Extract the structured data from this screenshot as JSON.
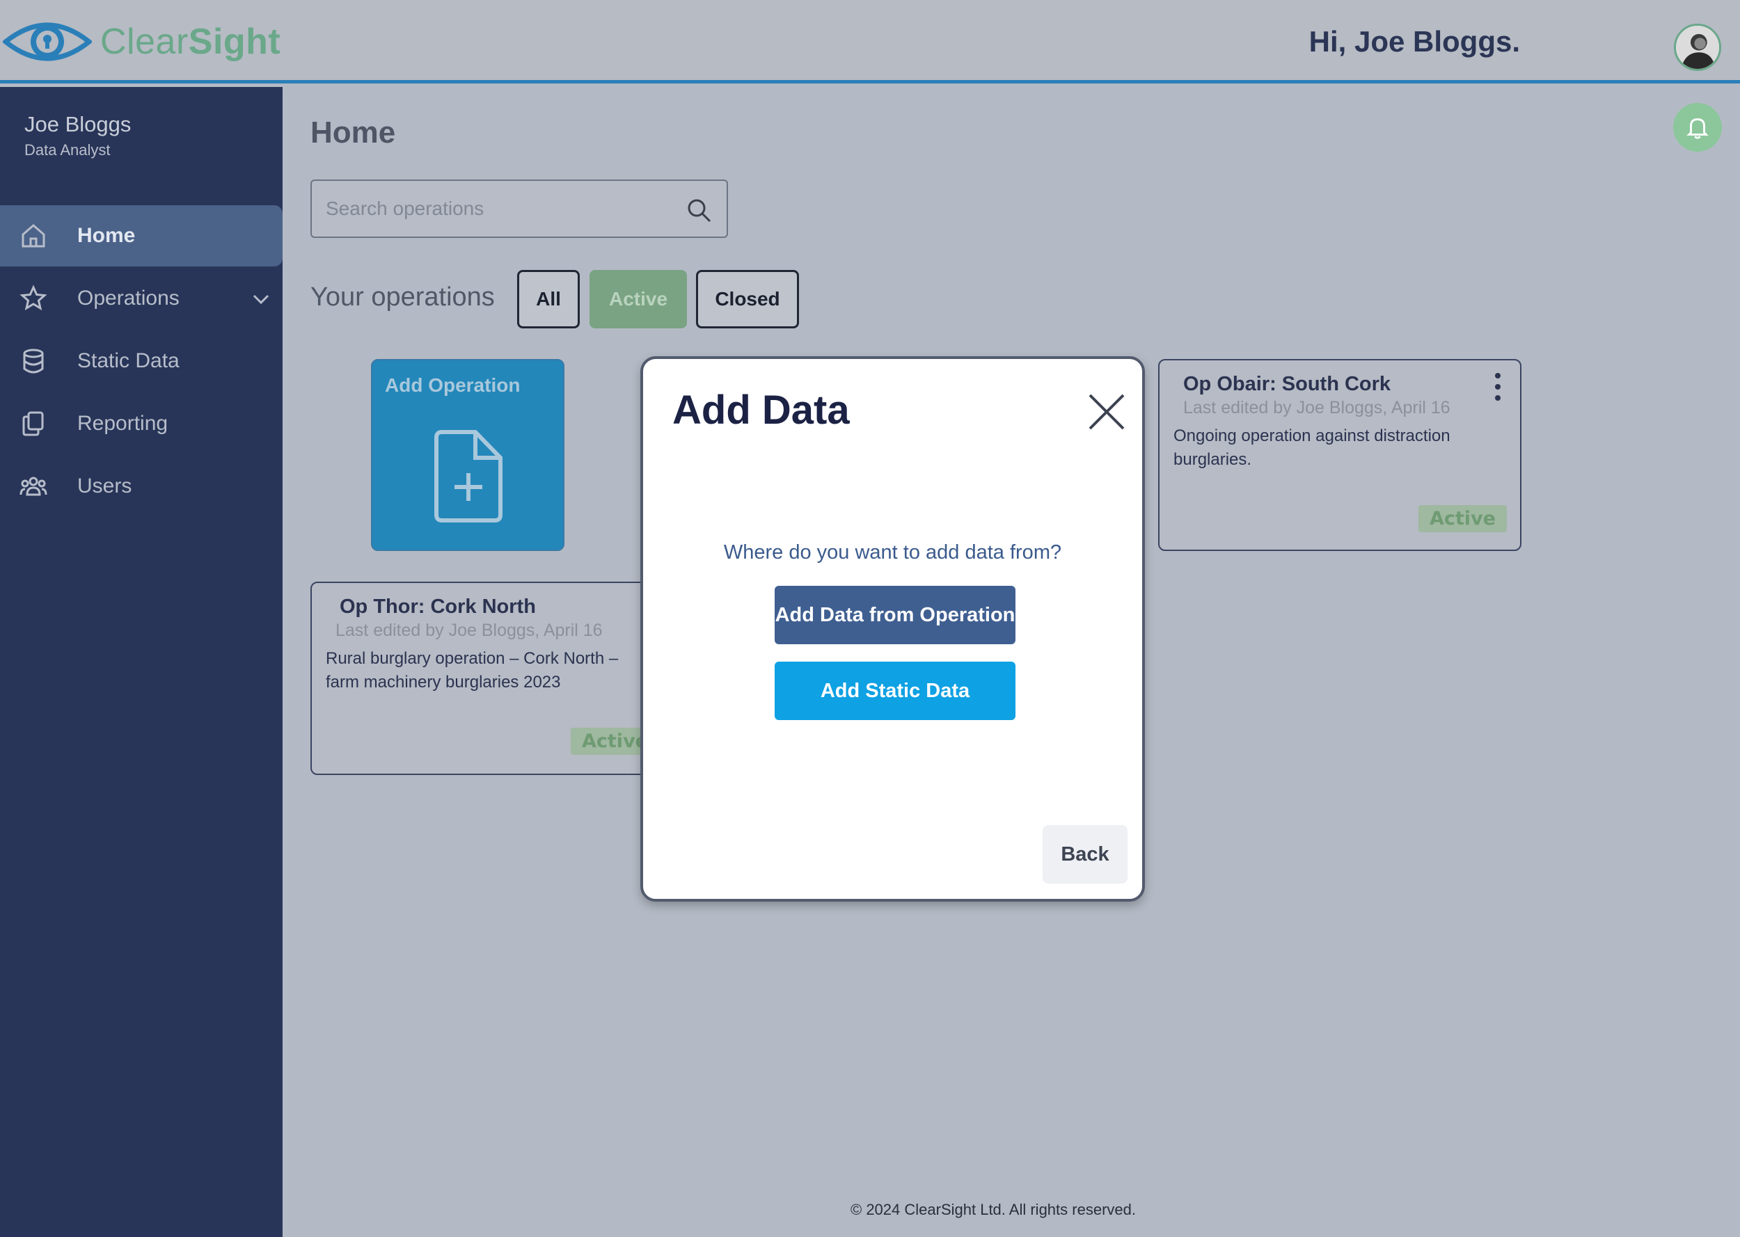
{
  "app": {
    "brand_light": "Clear",
    "brand_bold": "Sight",
    "greeting": "Hi, Joe Bloggs."
  },
  "user": {
    "name": "Joe Bloggs",
    "role": "Data Analyst"
  },
  "sidebar": {
    "items": [
      {
        "label": "Home",
        "icon": "home-icon",
        "active": true
      },
      {
        "label": "Operations",
        "icon": "star-icon",
        "has_chevron": true
      },
      {
        "label": "Static Data",
        "icon": "database-icon"
      },
      {
        "label": "Reporting",
        "icon": "copy-document-icon"
      },
      {
        "label": "Users",
        "icon": "users-icon"
      }
    ]
  },
  "main": {
    "page_title": "Home",
    "search_placeholder": "Search operations",
    "ops_heading": "Your operations",
    "filters": {
      "all": "All",
      "active": "Active",
      "closed": "Closed"
    },
    "add_operation_label": "Add Operation",
    "cards": [
      {
        "title": "Op Thor: Cork North",
        "edited": "Last edited by Joe Bloggs, April 16",
        "description_line1": "Rural burglary operation – Cork North –",
        "description_line2": "farm machinery burglaries 2023",
        "status": "Active"
      },
      {
        "title": "Op Obair: South Cork",
        "edited": "Last edited by Joe Bloggs, April 16",
        "description_line1": "Ongoing operation against distraction",
        "description_line2": "burglaries.",
        "status": "Active"
      }
    ]
  },
  "modal": {
    "title": "Add Data",
    "question": "Where do you want to add data from?",
    "btn_operation": "Add Data from Operation",
    "btn_static": "Add Static Data",
    "btn_back": "Back"
  },
  "footer": {
    "text": "© 2024 ClearSight Ltd. All rights reserved."
  },
  "colors": {
    "accent_blue": "#2a7fb8",
    "sidebar_bg": "#283558",
    "brand_green": "#6aa88a",
    "primary_button": "#3f5f91",
    "secondary_button": "#0ea1e3"
  }
}
